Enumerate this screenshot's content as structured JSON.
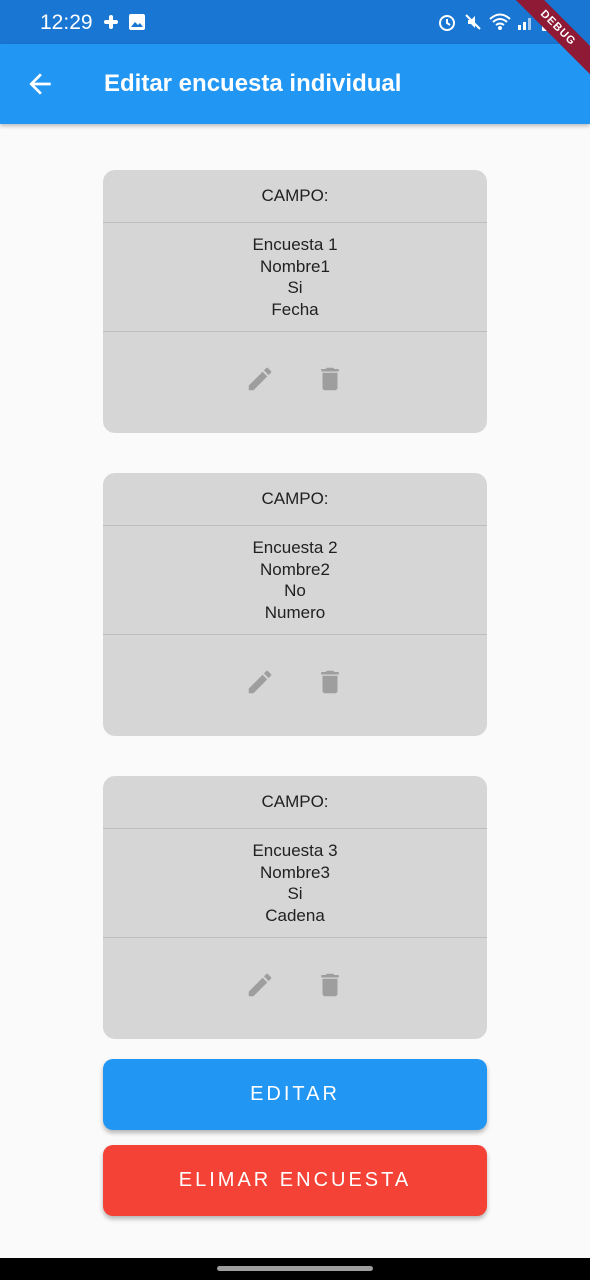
{
  "status_bar": {
    "time": "12:29",
    "left_icons": [
      "slack-icon",
      "image-icon"
    ],
    "right_icons": [
      "alarm-icon",
      "mute-icon",
      "wifi-icon",
      "signal-icon",
      "battery-icon"
    ]
  },
  "app_bar": {
    "title": "Editar encuesta individual",
    "back_icon": "arrow-back-icon"
  },
  "debug_banner": "DEBUG",
  "cards": [
    {
      "header": "CAMPO:",
      "lines": [
        "Encuesta 1",
        "Nombre1",
        "Si",
        "Fecha"
      ]
    },
    {
      "header": "CAMPO:",
      "lines": [
        "Encuesta 2",
        "Nombre2",
        "No",
        "Numero"
      ]
    },
    {
      "header": "CAMPO:",
      "lines": [
        "Encuesta 3",
        "Nombre3",
        "Si",
        "Cadena"
      ]
    }
  ],
  "actions": {
    "edit_icon": "pencil-icon",
    "delete_icon": "trash-icon"
  },
  "buttons": {
    "edit_label": "EDITAR",
    "delete_label": "ELIMAR ENCUESTA"
  },
  "colors": {
    "app_bar": "#2196f3",
    "status_bar": "#1976d2",
    "edit_button": "#2196f3",
    "delete_button": "#f44336",
    "card": "#d6d6d6"
  }
}
